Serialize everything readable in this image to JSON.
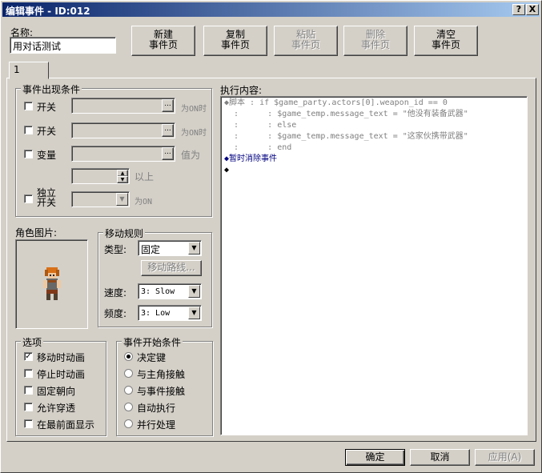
{
  "window": {
    "title": "编辑事件 - ID:012",
    "help_label": "?",
    "close_label": "X"
  },
  "name_label": "名称:",
  "name_value": "用对话测试",
  "toolbar": {
    "new_page": [
      "新建",
      "事件页"
    ],
    "copy_page": [
      "复制",
      "事件页"
    ],
    "paste_page": [
      "粘贴",
      "事件页"
    ],
    "delete_page": [
      "删除",
      "事件页"
    ],
    "clear_page": [
      "清空",
      "事件页"
    ]
  },
  "tabs": [
    {
      "label": "1"
    }
  ],
  "conditions": {
    "title": "事件出现条件",
    "switch1": {
      "label": "开关",
      "suffix": "为ON时",
      "checked": false
    },
    "switch2": {
      "label": "开关",
      "suffix": "为ON时",
      "checked": false
    },
    "variable": {
      "label": "变量",
      "suffix": "值为",
      "checked": false
    },
    "variable_value_suffix": "以上",
    "self_switch": {
      "label": [
        "独立",
        "开关"
      ],
      "suffix": "为ON",
      "checked": false
    },
    "browse_label": "..."
  },
  "graphic": {
    "label": "角色图片:"
  },
  "movement": {
    "title": "移动规则",
    "type_label": "类型:",
    "type_value": "固定",
    "route_button": "移动路线...",
    "speed_label": "速度:",
    "speed_value": "3: Slow",
    "freq_label": "频度:",
    "freq_value": "3: Low"
  },
  "options": {
    "title": "选项",
    "items": [
      {
        "label": "移动时动画",
        "checked": true
      },
      {
        "label": "停止时动画",
        "checked": false
      },
      {
        "label": "固定朝向",
        "checked": false
      },
      {
        "label": "允许穿透",
        "checked": false
      },
      {
        "label": "在最前面显示",
        "checked": false
      }
    ]
  },
  "trigger": {
    "title": "事件开始条件",
    "items": [
      {
        "label": "决定键",
        "selected": true
      },
      {
        "label": "与主角接触",
        "selected": false
      },
      {
        "label": "与事件接触",
        "selected": false
      },
      {
        "label": "自动执行",
        "selected": false
      },
      {
        "label": "并行处理",
        "selected": false
      }
    ]
  },
  "commands": {
    "label": "执行内容:",
    "lines": [
      "◆脚本 : if $game_party.actors[0].weapon_id == 0",
      "  :      : $game_temp.message_text = \"他没有装备武器\"",
      "  :      : else",
      "  :      : $game_temp.message_text = \"这家伙携带武器\"",
      "  :      : end",
      "◆暂时消除事件",
      "◆"
    ]
  },
  "footer": {
    "ok": "确定",
    "cancel": "取消",
    "apply": "应用(A)"
  },
  "colors": {
    "dialog_bg": "#d4d0c8",
    "title_start": "#0a246a",
    "title_end": "#a6caf0",
    "command_blue": "#000080",
    "script_gray": "#808080"
  }
}
